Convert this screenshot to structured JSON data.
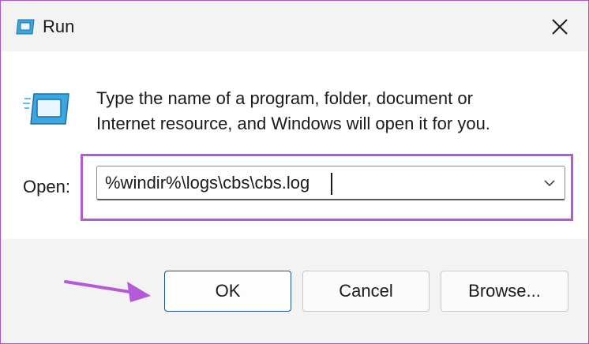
{
  "window": {
    "title": "Run",
    "title_icon": "run-dialog-icon",
    "close_icon": "close-icon",
    "highlight_color": "#b45ad8"
  },
  "content": {
    "icon": "run-program-icon",
    "message_line1": "Type the name of a program, folder, document or",
    "message_line2": "Internet resource, and Windows will open it for you.",
    "open_label": "Open:",
    "open_value": "%windir%\\logs\\cbs\\cbs.log",
    "dropdown_icon": "chevron-down-icon"
  },
  "buttons": {
    "ok": "OK",
    "cancel": "Cancel",
    "browse": "Browse..."
  },
  "annotation": {
    "arrow_icon": "pointer-arrow-icon",
    "arrow_color": "#b45ad8"
  }
}
